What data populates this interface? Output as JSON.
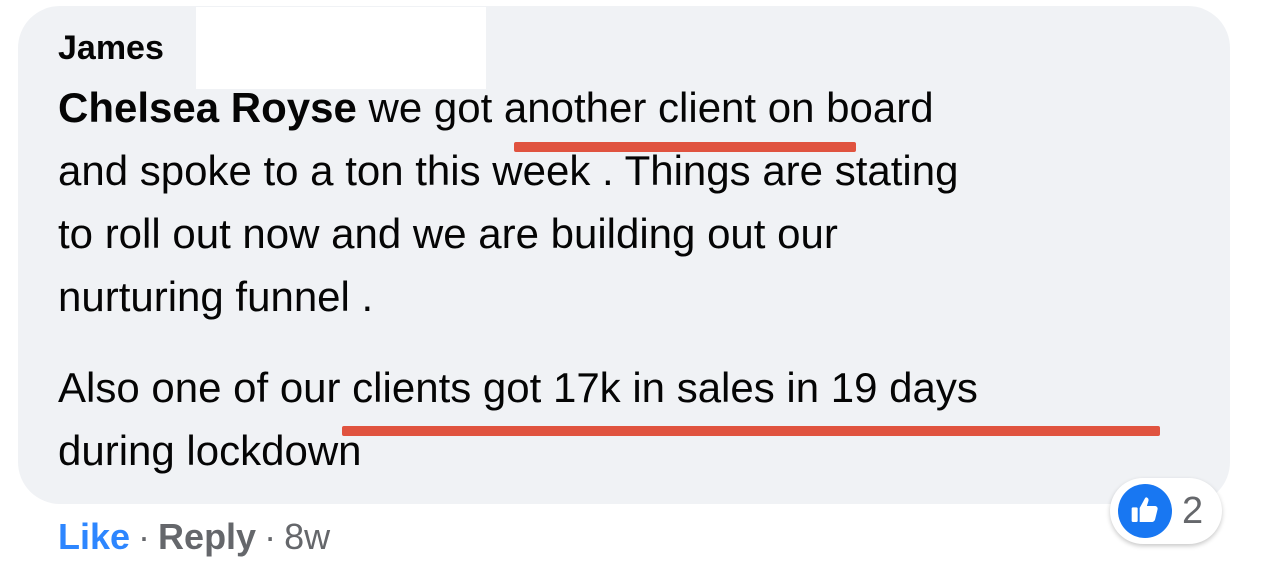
{
  "comment": {
    "author": "James",
    "mention": "Chelsea Royse",
    "lines": [
      " we got another client on board",
      "and spoke to a ton this week . Things are stating",
      "to roll out now and we are building out our",
      "nurturing funnel ."
    ],
    "paragraph2": [
      "Also one of our clients got 17k in sales in 19 days",
      "during lockdown"
    ]
  },
  "actions": {
    "like": "Like",
    "separator": "·",
    "reply": "Reply",
    "time": "8w"
  },
  "reactions": {
    "icon": "thumbs-up-icon",
    "count": "2"
  },
  "colors": {
    "bubble": "#f0f2f5",
    "highlight_underline": "#e0533f",
    "like_blue": "#2d86ff",
    "reaction_blue": "#1877f2"
  }
}
